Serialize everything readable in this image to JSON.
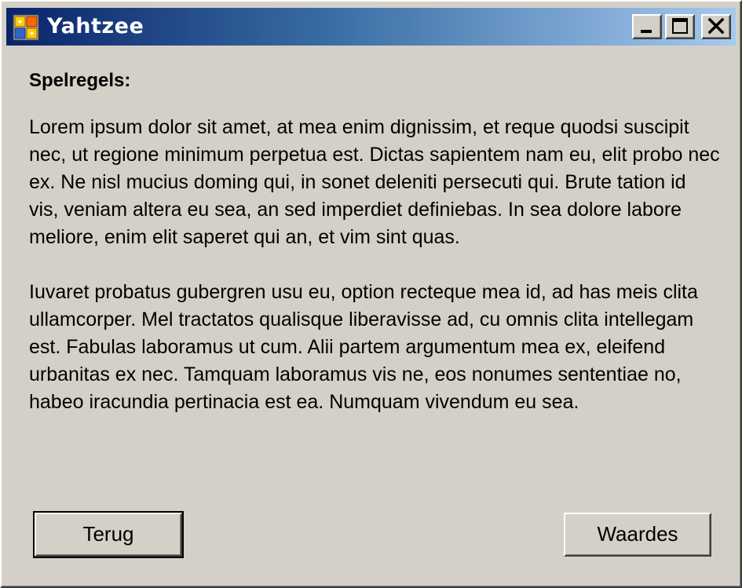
{
  "window": {
    "title": "Yahtzee",
    "icon": "yahtzee-app-icon"
  },
  "titlebar": {
    "minimize_icon": "minimize-icon",
    "maximize_icon": "maximize-icon",
    "close_icon": "close-icon"
  },
  "content": {
    "heading": "Spelregels:",
    "paragraphs": [
      "Lorem ipsum dolor sit amet, at mea enim dignissim, et reque quodsi suscipit nec, ut regione minimum perpetua est. Dictas sapientem nam eu, elit probo nec ex. Ne nisl mucius doming qui, in sonet deleniti persecuti qui. Brute tation id vis, veniam altera eu sea, an sed imperdiet definiebas. In sea dolore labore meliore, enim elit saperet qui an, et vim sint quas.",
      "Iuvaret probatus gubergren usu eu, option recteque mea id, ad has meis clita ullamcorper. Mel tractatos qualisque liberavisse ad, cu omnis clita intellegam est. Fabulas laboramus ut cum. Alii partem argumentum mea ex, eleifend urbanitas ex nec. Tamquam laboramus vis ne, eos nonumes sententiae no, habeo iracundia pertinacia est ea. Numquam vivendum eu sea."
    ]
  },
  "buttons": {
    "back_label": "Terug",
    "values_label": "Waardes"
  }
}
